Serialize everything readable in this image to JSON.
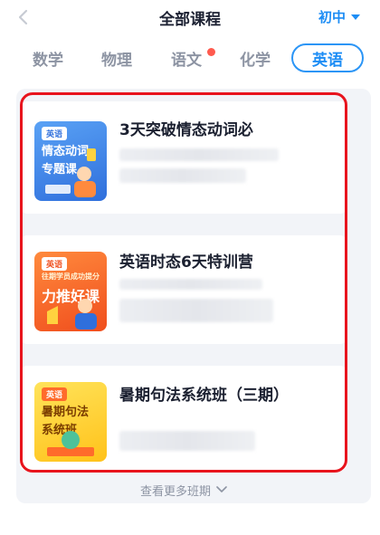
{
  "header": {
    "title": "全部课程",
    "grade": "初中"
  },
  "tabs": [
    {
      "label": "数学"
    },
    {
      "label": "物理"
    },
    {
      "label": "语文"
    },
    {
      "label": "化学"
    },
    {
      "label": "英语"
    }
  ],
  "courses": [
    {
      "title": "3天突破情态动词必",
      "thumb": {
        "tag": "英语",
        "line1": "情态动词",
        "line2": "专题课"
      }
    },
    {
      "title": "英语时态6天特训营",
      "thumb": {
        "tag": "英语",
        "small": "往期学员成功提分",
        "big": "力推好课"
      }
    },
    {
      "title": "暑期句法系统班（三期）",
      "thumb": {
        "tag": "英语",
        "line1": "暑期句法",
        "line2": "系统班"
      }
    }
  ],
  "more_label": "查看更多班期",
  "colors": {
    "accent": "#1d8df5",
    "highlight": "#e8141d",
    "thumb1": "#3d7fe0",
    "thumb2": "#ff6b2b",
    "thumb3": "#ffd43b"
  }
}
